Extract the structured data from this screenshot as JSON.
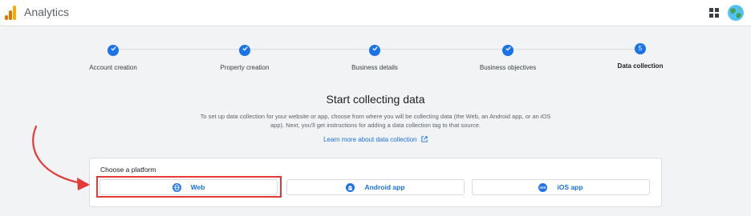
{
  "header": {
    "app_title": "Analytics",
    "logo_icon": "analytics-logo-icon",
    "apps_icon": "apps-grid-icon",
    "avatar_icon": "globe-avatar-icon"
  },
  "stepper": {
    "steps": [
      {
        "label": "Account creation",
        "state": "complete"
      },
      {
        "label": "Property creation",
        "state": "complete"
      },
      {
        "label": "Business details",
        "state": "complete"
      },
      {
        "label": "Business objectives",
        "state": "complete"
      },
      {
        "label": "Data collection",
        "state": "current",
        "number": "5"
      }
    ]
  },
  "main": {
    "headline": "Start collecting data",
    "description": "To set up data collection for your website or app, choose from where you will be collecting data (the Web, an Android app, or an iOS app). Next, you'll get instructions for adding a data collection tag to that source.",
    "learn_more_label": "Learn more about data collection"
  },
  "platform_card": {
    "title": "Choose a platform",
    "options": [
      {
        "label": "Web",
        "icon": "globe-icon",
        "highlighted": true
      },
      {
        "label": "Android app",
        "icon": "android-icon"
      },
      {
        "label": "iOS app",
        "icon": "ios-icon"
      }
    ]
  },
  "colors": {
    "accent": "#1a73e8",
    "annotation": "#e53935",
    "background": "#f1f3f4"
  }
}
